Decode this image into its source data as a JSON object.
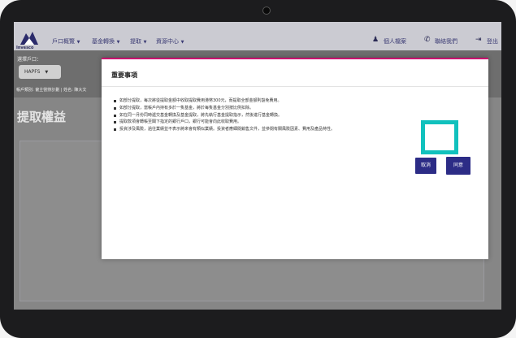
{
  "nav": {
    "brand": "Invesco",
    "menu": [
      {
        "label": "戶口概覽"
      },
      {
        "label": "基金轉換"
      },
      {
        "label": "提取"
      },
      {
        "label": "資源中心"
      }
    ],
    "right": [
      {
        "label": "個人檔案",
        "icon": "person-icon"
      },
      {
        "label": "聯絡我們",
        "icon": "phone-icon"
      },
      {
        "label": "登出",
        "icon": "logout-icon"
      }
    ]
  },
  "account": {
    "select_label": "選擇戶口：",
    "selected": "HAPFS",
    "info": "帳戶類別: 僱主營辦計劃 | 姓名: 陳大文"
  },
  "page": {
    "title": "提取權益"
  },
  "modal": {
    "title": "重要事項",
    "notes": [
      "如部分提取，每次將從提取金額中收取提取費用港幣300元，而提取全部金額則豁免費用。",
      "如部分提取，當帳戶內持有多於一隻基金，將於每隻基金分別按比例扣除。",
      "如在同一月份同時遞交基金轉換及基金提取，將先執行基金提取指示，然後進行基金轉換。",
      "提取款項會轉帳至閣下指定的銀行戶口，銀行可能會向此收取費用。",
      "投資涉及風險，過往業績並不表示將來會有類似業績。投資者應細閱銷售文件，並參閱有關風險因素、費用及產品特性。"
    ],
    "cancel_label": "取消",
    "agree_label": "同意"
  },
  "colors": {
    "nav_bg": "#cbcbd2",
    "brand_navy": "#2c2c86",
    "modal_accent": "#c8006e",
    "highlight": "#11c1bd"
  }
}
